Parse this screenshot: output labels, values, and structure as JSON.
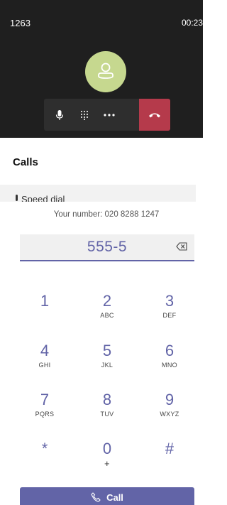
{
  "call": {
    "caller": "1263",
    "duration": "00:23",
    "avatar_icon": "person-icon",
    "controls": [
      {
        "name": "mic-button",
        "icon": "microphone-icon"
      },
      {
        "name": "dialpad-button",
        "icon": "dialpad-icon"
      },
      {
        "name": "more-button",
        "icon": "more-icon"
      },
      {
        "name": "hangup-button",
        "icon": "hangup-icon"
      }
    ],
    "colors": {
      "panel": "#1f1f1f",
      "avatar": "#c6d88f",
      "hangup": "#b53a4b"
    }
  },
  "calls_section": {
    "title": "Calls",
    "speed_dial": "Speed dial"
  },
  "dialpad": {
    "your_number": "Your number: 020 8288 1247",
    "value": "555-5",
    "backspace_icon": "backspace-icon",
    "keys": [
      {
        "digit": "1",
        "letters": ""
      },
      {
        "digit": "2",
        "letters": "ABC"
      },
      {
        "digit": "3",
        "letters": "DEF"
      },
      {
        "digit": "4",
        "letters": "GHI"
      },
      {
        "digit": "5",
        "letters": "JKL"
      },
      {
        "digit": "6",
        "letters": "MNO"
      },
      {
        "digit": "7",
        "letters": "PQRS"
      },
      {
        "digit": "8",
        "letters": "TUV"
      },
      {
        "digit": "9",
        "letters": "WXYZ"
      },
      {
        "digit": "*",
        "letters": ""
      },
      {
        "digit": "0",
        "letters": "+"
      },
      {
        "digit": "#",
        "letters": ""
      }
    ],
    "call_label": "Call",
    "accent": "#6264a7"
  }
}
